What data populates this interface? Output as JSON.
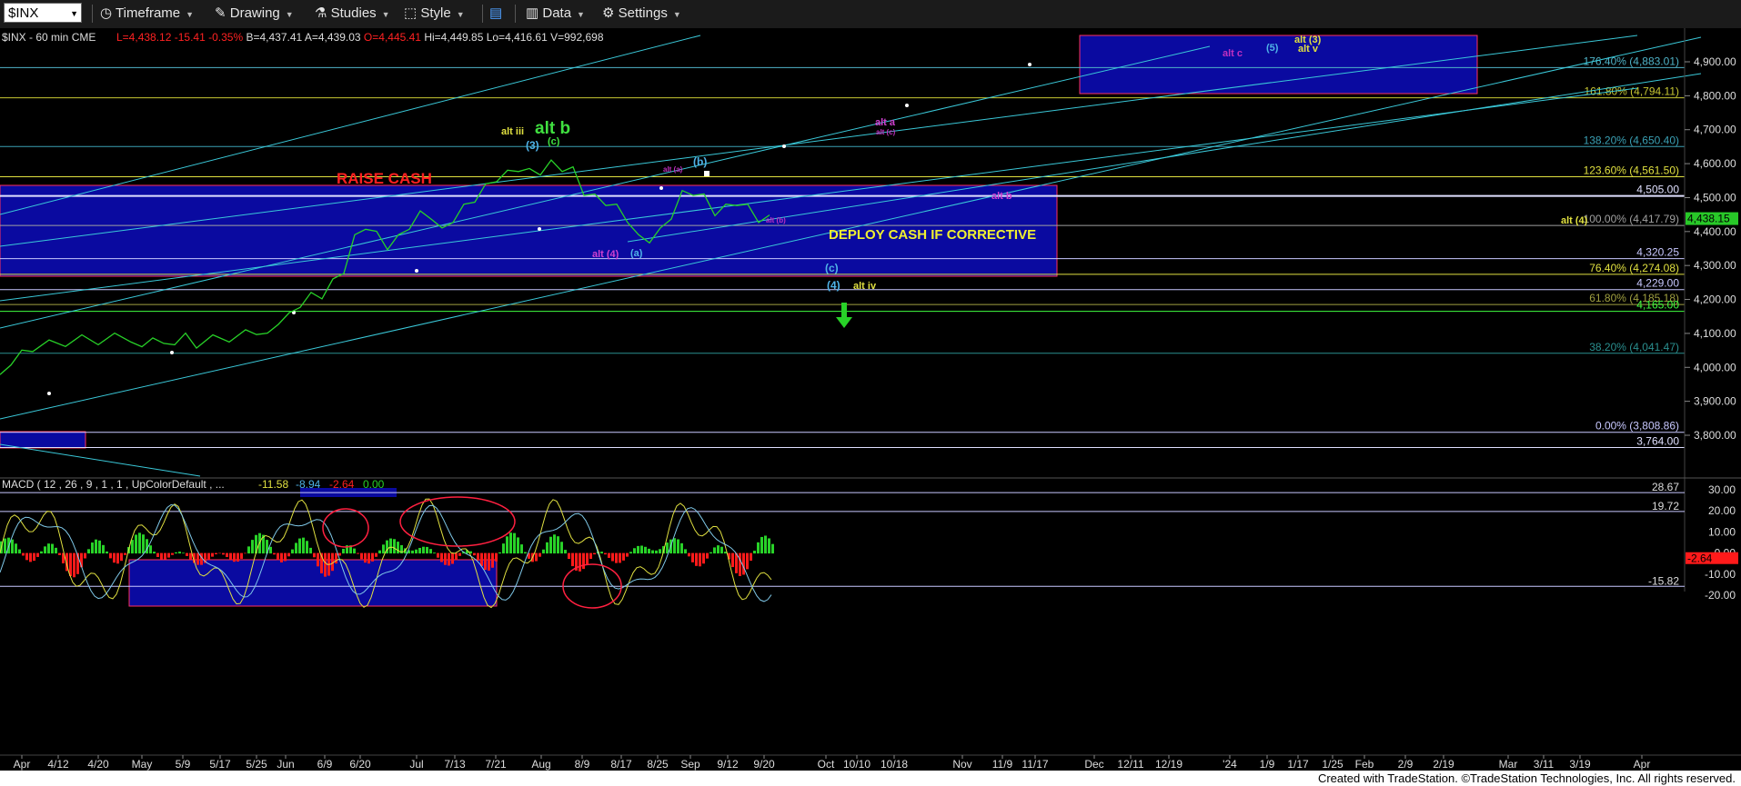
{
  "toolbar": {
    "symbol": "$INX",
    "items": [
      {
        "name": "timeframe",
        "label": "Timeframe",
        "icon": "clock-icon"
      },
      {
        "name": "drawing",
        "label": "Drawing",
        "icon": "pencil-icon"
      },
      {
        "name": "studies",
        "label": "Studies",
        "icon": "flask-icon"
      },
      {
        "name": "style",
        "label": "Style",
        "icon": "style-icon"
      },
      {
        "name": "layout",
        "label": "",
        "icon": "layout-icon"
      },
      {
        "name": "data",
        "label": "Data",
        "icon": "bar-chart-icon"
      },
      {
        "name": "settings",
        "label": "Settings",
        "icon": "gear-icon"
      }
    ]
  },
  "chart_data": {
    "type": "line",
    "header": {
      "symbol": "$INX - 60 min  CME",
      "quotes": [
        {
          "text": "L=4,438.12",
          "color": "#ff2222"
        },
        {
          "text": "-15.41",
          "color": "#ff2222"
        },
        {
          "text": "-0.35%",
          "color": "#ff2222"
        },
        {
          "text": "B=4,437.41",
          "color": "#dddddd"
        },
        {
          "text": "A=4,439.03",
          "color": "#dddddd"
        },
        {
          "text": "O=4,445.41",
          "color": "#ff2222"
        },
        {
          "text": "Hi=4,449.85",
          "color": "#dddddd"
        },
        {
          "text": "Lo=4,416.61",
          "color": "#dddddd"
        },
        {
          "text": "V=992,698",
          "color": "#dddddd"
        }
      ]
    },
    "price_axis": {
      "min": 3720,
      "max": 4960,
      "ticks": [
        "4,900.00",
        "4,800.00",
        "4,700.00",
        "4,600.00",
        "4,500.00",
        "4,400.00",
        "4,300.00",
        "4,200.00",
        "4,100.00",
        "4,000.00",
        "3,900.00",
        "3,800.00"
      ]
    },
    "last_price": {
      "label": "4,438.15",
      "value": 4438.15,
      "color": "#28c828"
    },
    "x_axis_labels": [
      "Apr",
      "4/12",
      "4/20",
      "May",
      "5/9",
      "5/17",
      "5/25",
      "Jun",
      "6/9",
      "6/20",
      "Jul",
      "7/13",
      "7/21",
      "Aug",
      "8/9",
      "8/17",
      "8/25",
      "Sep",
      "9/12",
      "9/20",
      "Oct",
      "10/10",
      "10/18",
      "Nov",
      "11/9",
      "11/17",
      "Dec",
      "12/11",
      "12/19",
      "'24",
      "1/9",
      "1/17",
      "1/25",
      "Feb",
      "2/9",
      "2/19",
      "Mar",
      "3/11",
      "3/19",
      "Apr"
    ],
    "levels": [
      {
        "value": 4883.01,
        "label": "176.40% (4,883.01)",
        "color": "#4fb3c8"
      },
      {
        "value": 4794.11,
        "label": "161.80% (4,794.11)",
        "color": "#c8c832"
      },
      {
        "value": 4650.4,
        "label": "138.20% (4,650.40)",
        "color": "#3aa0b4"
      },
      {
        "value": 4561.5,
        "label": "123.60% (4,561.50)",
        "color": "#e0e040"
      },
      {
        "value": 4505.0,
        "label": "4,505.00",
        "color": "#e0e0ff"
      },
      {
        "value": 4417.79,
        "label": "100.00% (4,417.79)",
        "color": "#a0a0a0"
      },
      {
        "value": 4320.25,
        "label": "4,320.25",
        "color": "#c8c8ff"
      },
      {
        "value": 4274.08,
        "label": "76.40% (4,274.08)",
        "color": "#e0e040"
      },
      {
        "value": 4229.0,
        "label": "4,229.00",
        "color": "#c8c8ff"
      },
      {
        "value": 4185.18,
        "label": "61.80% (4,185.18)",
        "color": "#a0a040"
      },
      {
        "value": 4165.0,
        "label": "4,165.00",
        "color": "#40ff40"
      },
      {
        "value": 4041.47,
        "label": "38.20% (4,041.47)",
        "color": "#2a8f8f"
      },
      {
        "value": 3808.86,
        "label": "0.00% (3,808.86)",
        "color": "#c8c8ff"
      },
      {
        "value": 3764.0,
        "label": "3,764.00",
        "color": "#e0e0ff"
      }
    ],
    "series": [
      {
        "name": "",
        "color": "#28d228",
        "values": [
          [
            0,
            3968
          ],
          [
            10,
            4020
          ],
          [
            20,
            4040
          ],
          [
            30,
            4060
          ],
          [
            45,
            4070
          ],
          [
            60,
            4075
          ],
          [
            75,
            4085
          ],
          [
            90,
            4080
          ],
          [
            105,
            4090
          ],
          [
            120,
            4088
          ],
          [
            130,
            4050
          ],
          [
            140,
            4100
          ],
          [
            150,
            4060
          ],
          [
            160,
            4080
          ],
          [
            170,
            4090
          ],
          [
            180,
            4070
          ],
          [
            195,
            4085
          ],
          [
            210,
            4088
          ],
          [
            225,
            4100
          ],
          [
            235,
            4110
          ],
          [
            245,
            4090
          ],
          [
            255,
            4140
          ],
          [
            265,
            4150
          ],
          [
            275,
            4190
          ],
          [
            285,
            4210
          ],
          [
            295,
            4215
          ],
          [
            305,
            4250
          ],
          [
            315,
            4290
          ],
          [
            325,
            4380
          ],
          [
            335,
            4420
          ],
          [
            345,
            4390
          ],
          [
            355,
            4360
          ],
          [
            365,
            4380
          ],
          [
            375,
            4420
          ],
          [
            385,
            4450
          ],
          [
            395,
            4450
          ],
          [
            405,
            4400
          ],
          [
            415,
            4440
          ],
          [
            425,
            4470
          ],
          [
            435,
            4500
          ],
          [
            445,
            4530
          ],
          [
            455,
            4560
          ],
          [
            465,
            4570
          ],
          [
            475,
            4590
          ],
          [
            485,
            4575
          ],
          [
            495,
            4580
          ],
          [
            505,
            4600
          ],
          [
            515,
            4590
          ],
          [
            525,
            4580
          ],
          [
            535,
            4520
          ],
          [
            545,
            4500
          ],
          [
            555,
            4490
          ],
          [
            565,
            4470
          ],
          [
            575,
            4440
          ],
          [
            585,
            4380
          ],
          [
            595,
            4380
          ],
          [
            605,
            4400
          ],
          [
            615,
            4450
          ],
          [
            625,
            4510
          ],
          [
            635,
            4520
          ],
          [
            645,
            4500
          ],
          [
            655,
            4460
          ],
          [
            665,
            4470
          ],
          [
            675,
            4490
          ],
          [
            685,
            4470
          ],
          [
            695,
            4440
          ],
          [
            705,
            4438
          ]
        ]
      }
    ],
    "annotations": [
      {
        "text": "alt (3)",
        "color": "#e0e040"
      },
      {
        "text": "(5)",
        "color": "#4fb3e8"
      },
      {
        "text": "alt v",
        "color": "#e0e040"
      },
      {
        "text": "alt c",
        "color": "#c030c0"
      },
      {
        "text": "alt a",
        "color": "#d040d0"
      },
      {
        "text": "alt (c)",
        "color": "#c030c0"
      },
      {
        "text": "alt b",
        "color": "#40e040"
      },
      {
        "text": "alt iii",
        "color": "#e0e040"
      },
      {
        "text": "(3)",
        "color": "#4fb3e8"
      },
      {
        "text": "(c)",
        "color": "#40e040"
      },
      {
        "text": "RAISE CASH",
        "color": "#ff2020"
      },
      {
        "text": "(b)",
        "color": "#4fb3e8"
      },
      {
        "text": "alt (a)",
        "color": "#c030c0"
      },
      {
        "text": "alt b",
        "color": "#d040d0"
      },
      {
        "text": "alt (b)",
        "color": "#c030c0"
      },
      {
        "text": "alt (4)",
        "color": "#e0e040"
      },
      {
        "text": "DEPLOY CASH IF CORRECTIVE",
        "color": "#f0f030"
      },
      {
        "text": "alt (4)",
        "color": "#d040d0"
      },
      {
        "text": "(a)",
        "color": "#4fb3e8"
      },
      {
        "text": "(c)",
        "color": "#4fb3e8"
      },
      {
        "text": "(4)",
        "color": "#4fb3e8"
      },
      {
        "text": "alt iv",
        "color": "#e0e040"
      }
    ],
    "macd": {
      "title": "MACD ( 12 , 26 , 9 , 1 , 1 , UpColorDefault , ...",
      "values": [
        {
          "text": "-11.58",
          "color": "#e0e040"
        },
        {
          "text": "-8.94",
          "color": "#4fb3e8"
        },
        {
          "text": "-2.64",
          "color": "#ff2020"
        },
        {
          "text": "0.00",
          "color": "#28d228"
        }
      ],
      "axis_ticks": [
        "30.00",
        "20.00",
        "10.00",
        "0.00",
        "-10.00",
        "-20.00"
      ],
      "levels": [
        {
          "value": 28.67,
          "label": "28.67"
        },
        {
          "value": 19.72,
          "label": "19.72"
        },
        {
          "value": -15.82,
          "label": "-15.82"
        }
      ],
      "last": {
        "label": "-2.64",
        "value": -2.64
      },
      "range": [
        -25,
        32
      ]
    }
  },
  "footer": {
    "text": "Created with TradeStation. ©TradeStation Technologies, Inc. All rights reserved."
  }
}
